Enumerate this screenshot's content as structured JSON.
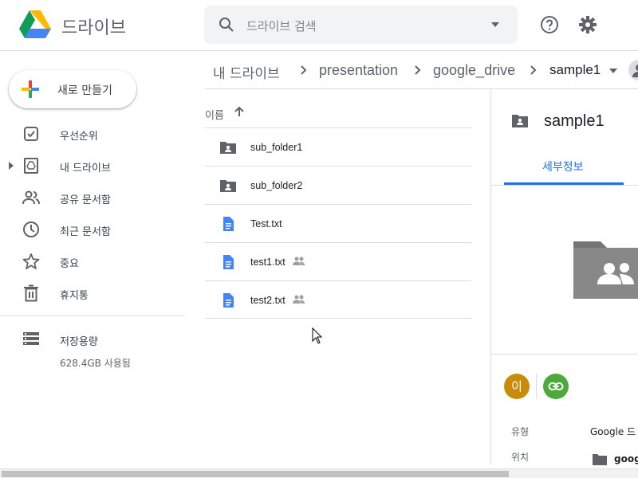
{
  "app": {
    "title": "드라이브"
  },
  "search": {
    "placeholder": "드라이브 검색"
  },
  "header": {
    "help_icon": "help-icon",
    "settings_icon": "gear-icon"
  },
  "sidebar": {
    "new_button": "새로 만들기",
    "items": [
      {
        "label": "우선순위",
        "icon": "priority-check-icon"
      },
      {
        "label": "내 드라이브",
        "icon": "my-drive-icon"
      },
      {
        "label": "공유 문서함",
        "icon": "shared-people-icon"
      },
      {
        "label": "최근 문서함",
        "icon": "clock-icon"
      },
      {
        "label": "중요",
        "icon": "star-icon"
      },
      {
        "label": "휴지통",
        "icon": "trash-icon"
      }
    ],
    "storage": {
      "label": "저장용량",
      "used": "628.4GB 사용됨"
    }
  },
  "breadcrumb": [
    "내 드라이브",
    "presentation",
    "google_drive",
    "sample1"
  ],
  "file_list": {
    "column_name": "이름",
    "files": [
      {
        "name": "sub_folder1",
        "type": "shared-folder",
        "shared": false
      },
      {
        "name": "sub_folder2",
        "type": "shared-folder",
        "shared": false
      },
      {
        "name": "Test.txt",
        "type": "doc",
        "shared": false
      },
      {
        "name": "test1.txt",
        "type": "doc",
        "shared": true
      },
      {
        "name": "test2.txt",
        "type": "doc",
        "shared": true
      }
    ]
  },
  "details": {
    "title": "sample1",
    "tab": "세부정보",
    "avatar_letter": "이",
    "rows": [
      {
        "label": "유형",
        "value": "Google 드"
      },
      {
        "label": "위치",
        "value": "goog"
      }
    ]
  },
  "colors": {
    "accent": "#1a73e8",
    "avatar": "#c98c0a",
    "link": "#4caa3a",
    "doc_icon": "#4285f4",
    "folder": "#5f6368"
  }
}
